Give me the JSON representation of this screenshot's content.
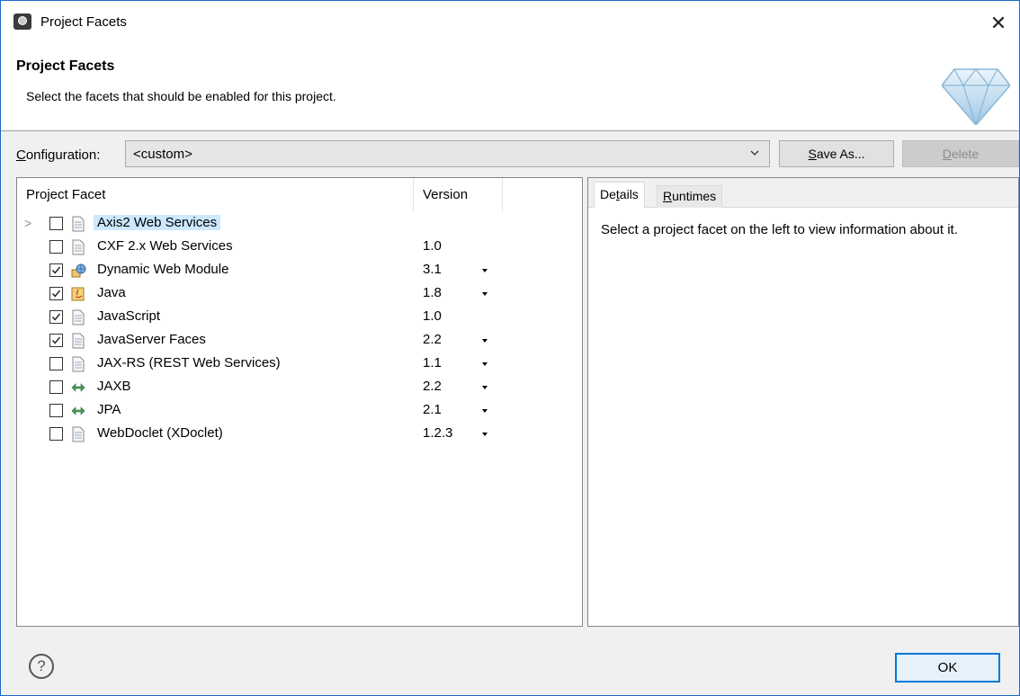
{
  "window": {
    "title": "Project Facets",
    "close_glyph": "✕",
    "app_icon": "eclipse-icon"
  },
  "banner": {
    "title": "Project Facets",
    "description": "Select the facets that should be enabled for this project.",
    "icon": "gem-icon"
  },
  "configuration": {
    "label_mnemonic": "C",
    "label_rest": "onfiguration:",
    "value": "<custom>",
    "save_as_mnemonic": "S",
    "save_as_rest": "ave As...",
    "delete_mnemonic": "D",
    "delete_rest": "elete"
  },
  "table": {
    "headers": {
      "name": "Project Facet",
      "version": "Version"
    },
    "rows": [
      {
        "label": "Axis2 Web Services",
        "version": "",
        "checked": false,
        "expandable": true,
        "selected": true,
        "icon": "page-icon",
        "dropdown": false
      },
      {
        "label": "CXF 2.x Web Services",
        "version": "1.0",
        "checked": false,
        "expandable": false,
        "selected": false,
        "icon": "page-icon",
        "dropdown": false
      },
      {
        "label": "Dynamic Web Module",
        "version": "3.1",
        "checked": true,
        "expandable": false,
        "selected": false,
        "icon": "web-module-icon",
        "dropdown": true
      },
      {
        "label": "Java",
        "version": "1.8",
        "checked": true,
        "expandable": false,
        "selected": false,
        "icon": "java-icon",
        "dropdown": true
      },
      {
        "label": "JavaScript",
        "version": "1.0",
        "checked": true,
        "expandable": false,
        "selected": false,
        "icon": "page-icon",
        "dropdown": false
      },
      {
        "label": "JavaServer Faces",
        "version": "2.2",
        "checked": true,
        "expandable": false,
        "selected": false,
        "icon": "page-icon",
        "dropdown": true
      },
      {
        "label": "JAX-RS (REST Web Services)",
        "version": "1.1",
        "checked": false,
        "expandable": false,
        "selected": false,
        "icon": "page-icon",
        "dropdown": true
      },
      {
        "label": "JAXB",
        "version": "2.2",
        "checked": false,
        "expandable": false,
        "selected": false,
        "icon": "arrows-icon",
        "dropdown": true
      },
      {
        "label": "JPA",
        "version": "2.1",
        "checked": false,
        "expandable": false,
        "selected": false,
        "icon": "arrows-icon",
        "dropdown": true
      },
      {
        "label": "WebDoclet (XDoclet)",
        "version": "1.2.3",
        "checked": false,
        "expandable": false,
        "selected": false,
        "icon": "page-icon",
        "dropdown": true
      }
    ]
  },
  "details": {
    "tabs": [
      {
        "mnemonic_pre": "De",
        "mnemonic": "t",
        "rest": "ails"
      },
      {
        "mnemonic_pre": "",
        "mnemonic": "R",
        "rest": "untimes"
      }
    ],
    "text": "Select a project facet on the left to view information about it."
  },
  "footer": {
    "help_glyph": "?",
    "ok_label": "OK"
  }
}
